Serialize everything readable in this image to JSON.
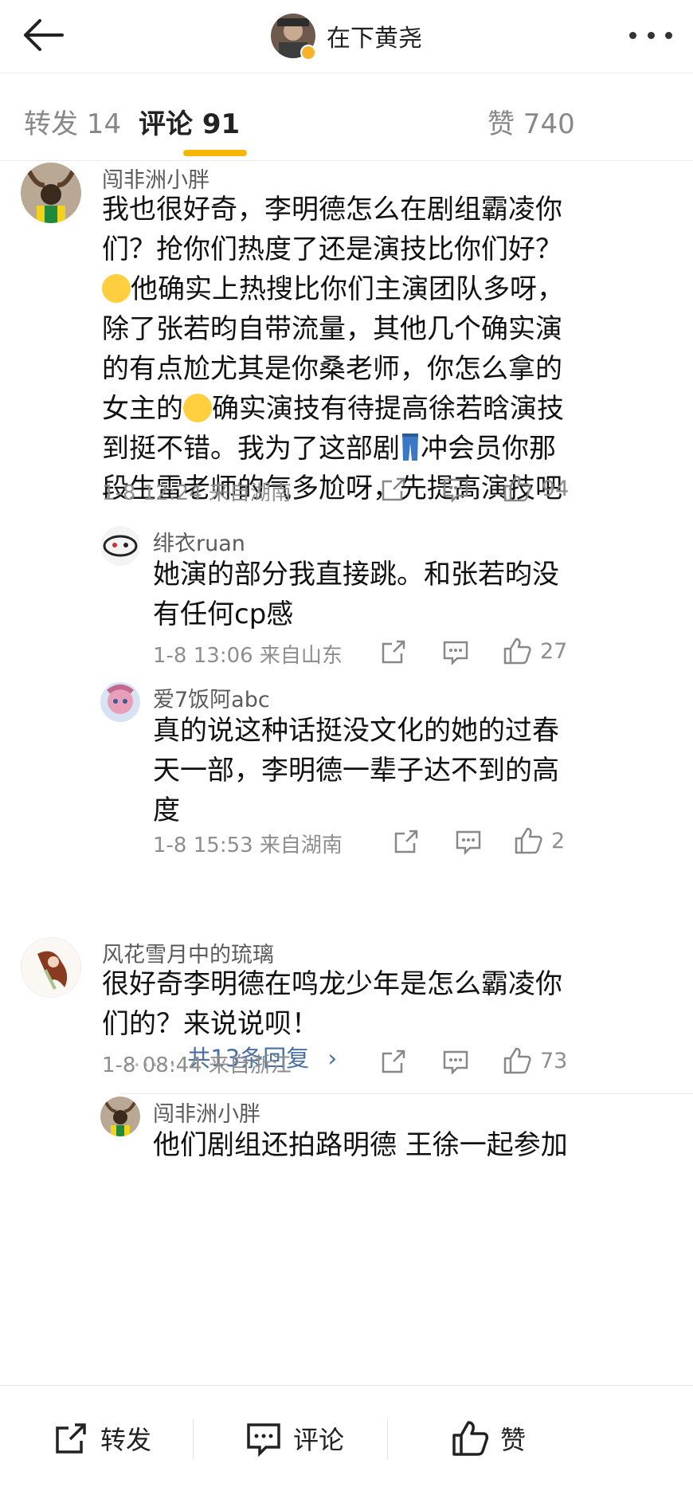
{
  "header": {
    "user_name": "在下黄尧"
  },
  "tabs": [
    {
      "label": "转发 14"
    },
    {
      "label": "评论 91"
    },
    {
      "label": "赞 740"
    }
  ],
  "comments": [
    {
      "name": "闯非洲小胖",
      "text_lines": [
        "我也很好奇，李明德怎么在剧组霸凌你",
        "们？抢你们热度了还是演技比你们好？",
        "他确实上热搜比你们主演团队多呀，",
        "除了张若昀自带流量，其他几个确实演",
        "的有点尬尤其是你桑老师，你怎么拿的",
        "女主的",
        "确实演技有待提高徐若晗演技",
        "到挺不错。我为了这部剧",
        "冲会员你那",
        "段生雷老师的气多尬呀，先提高演技吧"
      ],
      "meta": "1-8 12:24  来自湖南",
      "likes": "94"
    },
    {
      "name": "绯衣ruan",
      "text_lines": [
        "她演的部分我直接跳。和张若昀没",
        "有任何cp感"
      ],
      "meta": "1-8 13:06  来自山东",
      "likes": "27"
    },
    {
      "name": "爱7饭阿abc",
      "text_lines": [
        "真的说这种话挺没文化的她的过春",
        "天一部，李明德一辈子达不到的高",
        "度"
      ],
      "meta": "1-8 15:53  来自湖南",
      "likes": "2"
    },
    {
      "name": "风花雪月中的琉璃",
      "text_lines": [
        "很好奇李明德在鸣龙少年是怎么霸凌你",
        "们的？来说说呗！"
      ],
      "meta": "1-8 08:44  来自浙江",
      "likes": "73"
    },
    {
      "name": "闯非洲小胖",
      "text_lines": [
        "他们剧组还拍路明德 王徐一起参加"
      ]
    }
  ],
  "replies_more": {
    "dots": "......",
    "label": "共13条回复",
    "chevron": "›"
  },
  "bottom_bar": {
    "repost_label": "转发",
    "comment_label": "评论",
    "like_label": "赞"
  },
  "icons": {
    "back": "back-arrow-icon",
    "more": "more-dots-icon",
    "repost": "share-icon",
    "comment": "comment-icon",
    "like": "thumbs-up-icon",
    "verified": "verified-badge-icon"
  },
  "colors": {
    "accent": "#f7b500",
    "link": "#4a6fa5",
    "meta": "#8e8e8e"
  }
}
